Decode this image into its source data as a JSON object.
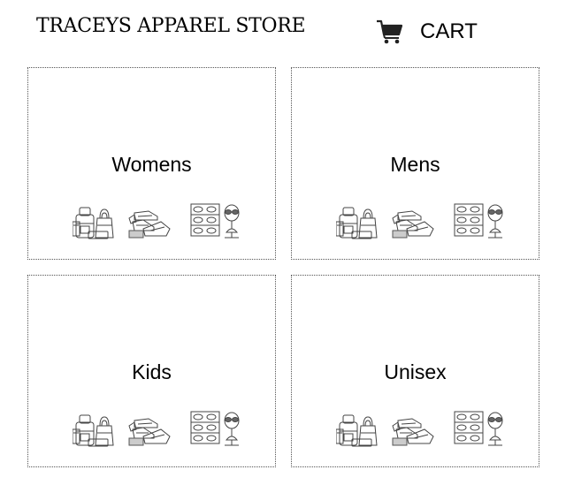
{
  "header": {
    "store_name": "TRACEYS APPAREL STORE",
    "cart_label": "CART",
    "cart_icon": "shopping-cart-icon"
  },
  "categories": [
    {
      "label": "Womens",
      "art_icon": "apparel-line-art-icon"
    },
    {
      "label": "Mens",
      "art_icon": "apparel-line-art-icon"
    },
    {
      "label": "Kids",
      "art_icon": "apparel-line-art-icon"
    },
    {
      "label": "Unisex",
      "art_icon": "apparel-line-art-icon"
    }
  ]
}
